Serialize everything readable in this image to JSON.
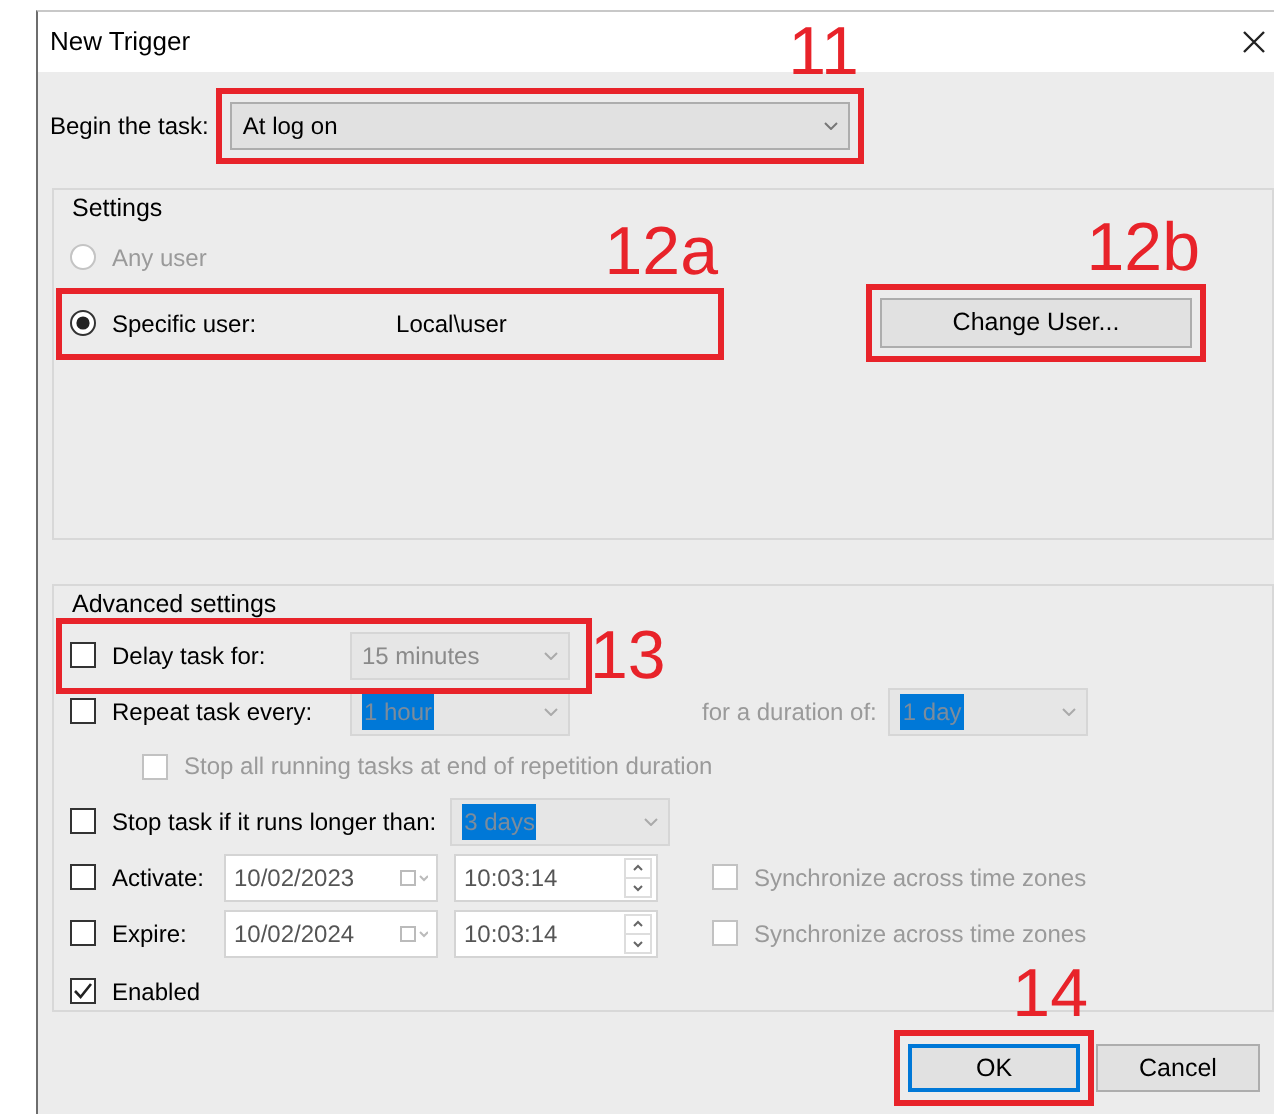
{
  "window": {
    "title": "New Trigger"
  },
  "begin_task": {
    "label": "Begin the task:",
    "value": "At log on",
    "callout": "11"
  },
  "settings": {
    "title": "Settings",
    "users": [
      {
        "label": "Any user",
        "selected": false,
        "disabled": true
      },
      {
        "label": "Specific user:",
        "selected": true,
        "disabled": false,
        "value": "Local\\user",
        "callout": "12a"
      }
    ],
    "change_user": {
      "label": "Change User...",
      "callout": "12b"
    }
  },
  "advanced": {
    "title": "Advanced settings",
    "rows": [
      {
        "kind": "combo",
        "label": "Delay task for:",
        "checked": false,
        "value": "15 minutes",
        "highlighted": false,
        "callout": "13"
      },
      {
        "kind": "combo2",
        "label": "Repeat task every:",
        "checked": false,
        "value": "1 hour",
        "highlighted": true,
        "second_label": "for a duration of:",
        "second_value": "1 day"
      },
      {
        "kind": "sub",
        "label": "Stop all running tasks at end of repetition duration",
        "checked": false,
        "disabled": true
      },
      {
        "kind": "combo",
        "label": "Stop task if it runs longer than:",
        "checked": false,
        "value": "3 days",
        "highlighted": true
      },
      {
        "kind": "datetime",
        "label": "Activate:",
        "checked": false,
        "date": "10/02/2023",
        "time": "10:03:14",
        "sync_label": "Synchronize across time zones",
        "sync_checked": false
      },
      {
        "kind": "datetime",
        "label": "Expire:",
        "checked": false,
        "date": "10/02/2024",
        "time": "10:03:14",
        "sync_label": "Synchronize across time zones",
        "sync_checked": false
      },
      {
        "kind": "check",
        "label": "Enabled",
        "checked": true
      }
    ]
  },
  "buttons": [
    {
      "label": "OK",
      "default": true,
      "callout": "14"
    },
    {
      "label": "Cancel",
      "default": false
    }
  ]
}
